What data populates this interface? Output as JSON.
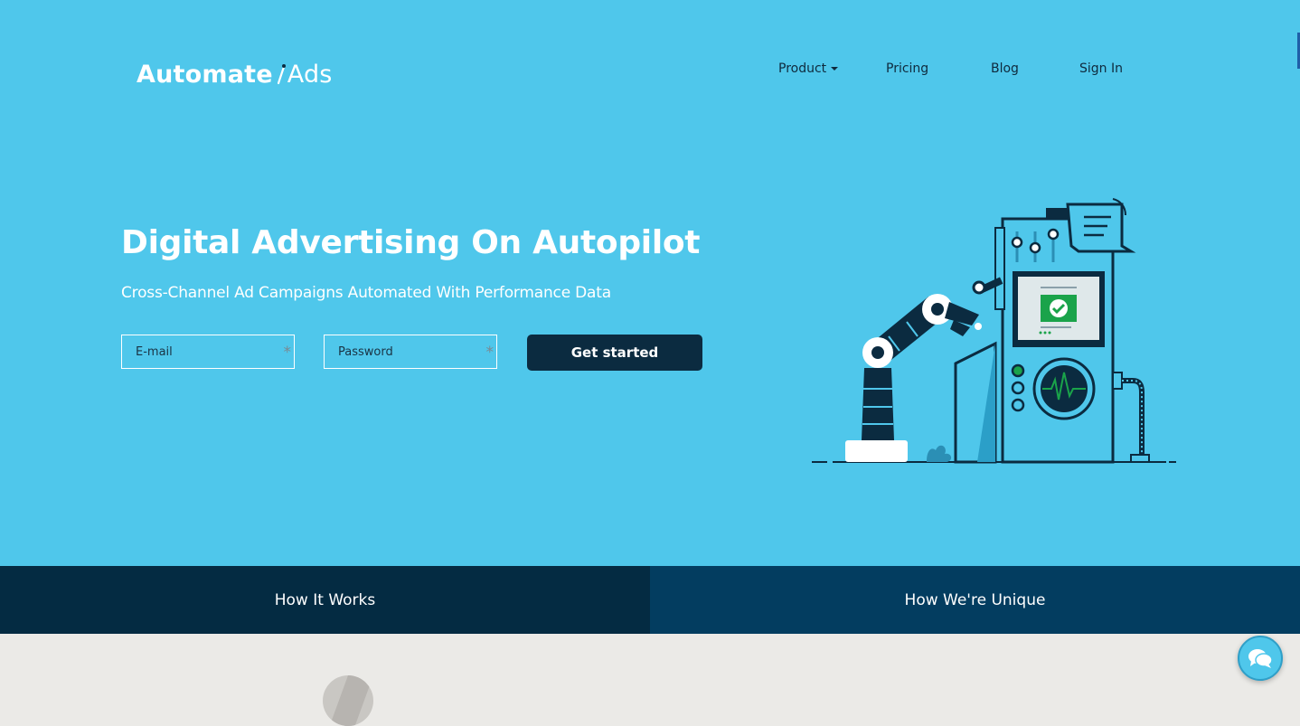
{
  "brand": {
    "name_bold": "Automate",
    "name_light": "Ads"
  },
  "nav": {
    "product": "Product",
    "pricing": "Pricing",
    "blog": "Blog",
    "signin": "Sign In"
  },
  "hero": {
    "headline": "Digital Advertising On Autopilot",
    "subheadline": "Cross-Channel Ad Campaigns Automated With Performance Data",
    "email_placeholder": "E-mail",
    "password_placeholder": "Password",
    "required_mark": "*",
    "cta_label": "Get started"
  },
  "tabs": [
    {
      "label": "How It Works"
    },
    {
      "label": "How We're Unique"
    }
  ],
  "icons": {
    "product_dropdown": "caret-down-icon",
    "chat": "chat-bubbles-icon",
    "illustration": "robot-arm-machine-illustration"
  },
  "colors": {
    "hero_bg": "#4fc7eb",
    "navy": "#0b2b40",
    "tab_left": "#042b42",
    "tab_right": "#033d60",
    "success_green": "#1aa34a",
    "page_bg": "#ebeae7"
  }
}
